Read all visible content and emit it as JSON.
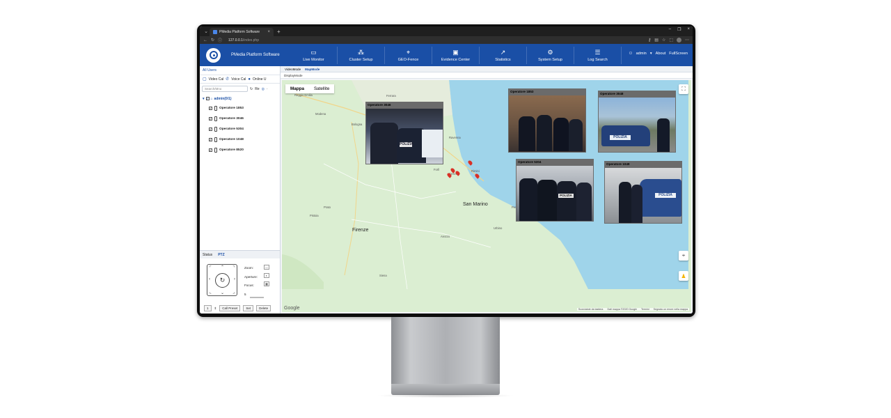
{
  "browser": {
    "tab_title": "PMedia Platform Software",
    "url_host": "127.0.0.1",
    "url_path": "/index.php"
  },
  "header": {
    "brand": "PMedia Platform Software",
    "nav": [
      {
        "label": "Live Monitor",
        "icon": "camera-icon"
      },
      {
        "label": "Cluster Setup",
        "icon": "cluster-icon"
      },
      {
        "label": "GEO-Fence",
        "icon": "location-icon"
      },
      {
        "label": "Evidence Center",
        "icon": "folder-icon"
      },
      {
        "label": "Statistics",
        "icon": "chart-icon"
      },
      {
        "label": "System Setup",
        "icon": "gear-icon"
      },
      {
        "label": "Log Search",
        "icon": "log-icon"
      }
    ],
    "user": "admin",
    "about": "About",
    "fullscreen": "FullScreen"
  },
  "left": {
    "title": "All Users",
    "tools": [
      "Video Cal",
      "Voice Cal",
      "Online U"
    ],
    "search_placeholder": "Search/Mno",
    "refresh_label": "Re",
    "root": "admin(0/1)",
    "users": [
      "Operatore 1853",
      "Operatore 3046",
      "Operatore 5304",
      "Operatore 1048",
      "Operatore 8520"
    ],
    "bottom_tabs": [
      "Status",
      "PTZ"
    ],
    "ptz_labels": [
      "Zoom:",
      "Aperture:",
      "Focus:"
    ],
    "speed": "5",
    "preset_value": "1",
    "buttons": [
      "Call Preset",
      "Set",
      "Delete"
    ]
  },
  "main": {
    "modes": [
      "VideoMode",
      "MapMode"
    ],
    "display_mode": "DisplayMode"
  },
  "map": {
    "types": [
      "Mappa",
      "Satellite"
    ],
    "cities_big": [
      "Firenze",
      "San Marino"
    ],
    "cities_small": [
      "Reggio Emilia",
      "Modena",
      "Bologna",
      "Ravenna",
      "Forlì",
      "Cesena",
      "Rimini",
      "Prato",
      "Pistoia",
      "Arezzo",
      "Siena",
      "Imola",
      "Faenza",
      "Ferrara",
      "Urbino",
      "Pesaro"
    ],
    "google": "Google",
    "attribution": [
      "Scorciatoie da tastiera",
      "Dati mappa ©2020 Google",
      "Termini",
      "Segnala un errore nella mappa"
    ]
  },
  "popups": [
    {
      "title": "Operatore 3046"
    },
    {
      "title": "Operatore 1853"
    },
    {
      "title": "Operatore 3048"
    },
    {
      "title": "Operatore 5304"
    },
    {
      "title": "Operatore 1049"
    }
  ]
}
